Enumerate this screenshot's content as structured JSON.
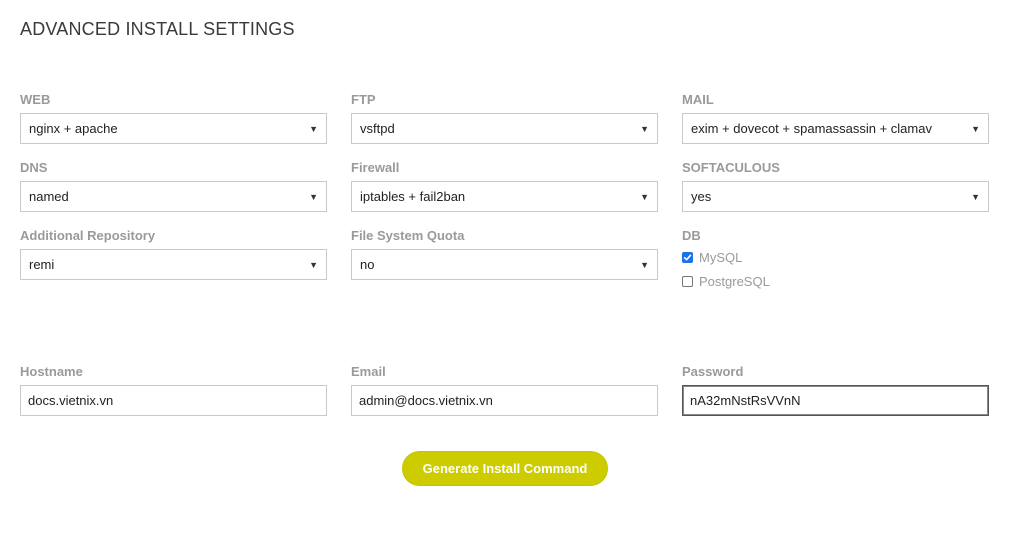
{
  "page": {
    "title": "ADVANCED INSTALL SETTINGS"
  },
  "selects": {
    "web": {
      "label": "WEB",
      "value": "nginx + apache"
    },
    "ftp": {
      "label": "FTP",
      "value": "vsftpd"
    },
    "mail": {
      "label": "MAIL",
      "value": "exim + dovecot + spamassassin + clamav"
    },
    "dns": {
      "label": "DNS",
      "value": "named"
    },
    "firewall": {
      "label": "Firewall",
      "value": "iptables + fail2ban"
    },
    "softaculous": {
      "label": "SOFTACULOUS",
      "value": "yes"
    },
    "repository": {
      "label": "Additional Repository",
      "value": "remi"
    },
    "quota": {
      "label": "File System Quota",
      "value": "no"
    }
  },
  "db": {
    "label": "DB",
    "options": [
      {
        "label": "MySQL",
        "checked": true
      },
      {
        "label": "PostgreSQL",
        "checked": false
      }
    ]
  },
  "inputs": {
    "hostname": {
      "label": "Hostname",
      "value": "docs.vietnix.vn"
    },
    "email": {
      "label": "Email",
      "value": "admin@docs.vietnix.vn"
    },
    "password": {
      "label": "Password",
      "value": "nA32mNstRsVVnN"
    }
  },
  "actions": {
    "generate_label": "Generate Install Command"
  },
  "icons": {
    "dropdown": "chevron-down-icon",
    "check": "checkmark-icon"
  },
  "colors": {
    "accent": "#cccc00",
    "checkbox": "#1a73e8",
    "label": "#9a9a9a"
  }
}
